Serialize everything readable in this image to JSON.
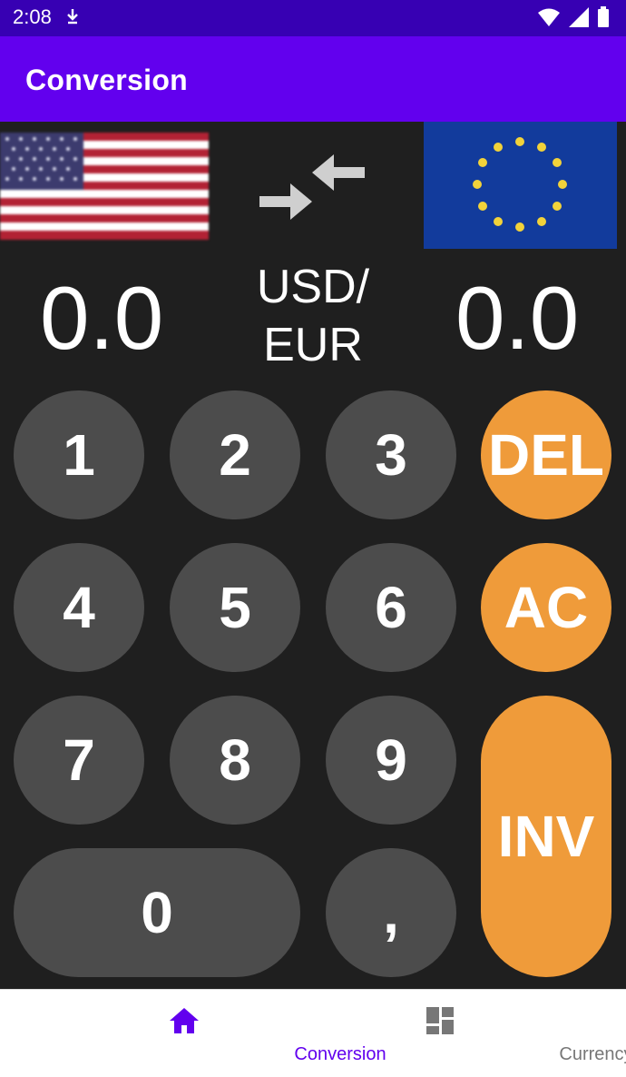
{
  "status_bar": {
    "time": "2:08"
  },
  "app_bar": {
    "title": "Conversion"
  },
  "converter": {
    "from_amount": "0.0",
    "to_amount": "0.0",
    "pair_line1": "USD/",
    "pair_line2": "EUR",
    "from_flag": "us-flag",
    "to_flag": "eu-flag"
  },
  "keypad": {
    "k1": "1",
    "k2": "2",
    "k3": "3",
    "k4": "4",
    "k5": "5",
    "k6": "6",
    "k7": "7",
    "k8": "8",
    "k9": "9",
    "k0": "0",
    "comma": ",",
    "del": "DEL",
    "ac": "AC",
    "inv": "INV"
  },
  "bottom_nav": {
    "items": [
      {
        "label": "Conversion",
        "icon": "home-icon",
        "active": true
      },
      {
        "label": "Currency",
        "icon": "dashboard-icon",
        "active": false
      }
    ]
  },
  "colors": {
    "status_bar": "#3700b3",
    "app_bar": "#6200ee",
    "background": "#1f1f1f",
    "number_key": "#4c4c4c",
    "action_key": "#ef9b3a",
    "active_nav": "#6200ee"
  }
}
